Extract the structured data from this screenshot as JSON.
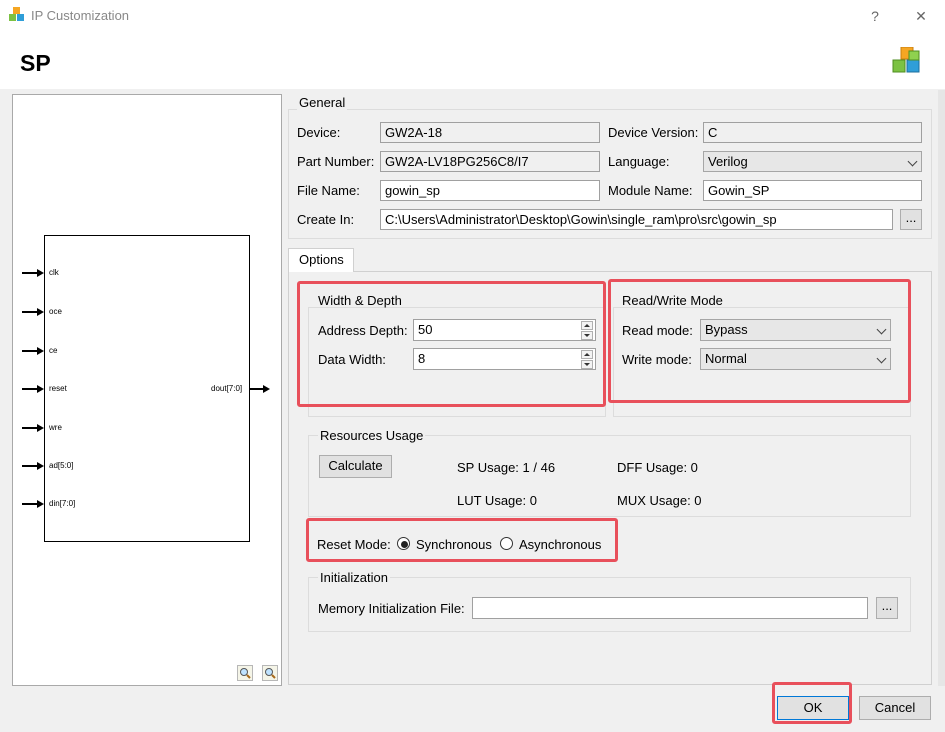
{
  "window": {
    "title": "IP Customization",
    "help_glyph": "?",
    "close_glyph": "✕"
  },
  "dialog": {
    "heading": "SP"
  },
  "preview": {
    "inputs": [
      "clk",
      "oce",
      "ce",
      "reset",
      "wre",
      "ad[5:0]",
      "din[7:0]"
    ],
    "output": "dout[7:0]"
  },
  "general": {
    "title": "General",
    "device_label": "Device:",
    "device_value": "GW2A-18",
    "device_version_label": "Device Version:",
    "device_version_value": "C",
    "part_number_label": "Part Number:",
    "part_number_value": "GW2A-LV18PG256C8/I7",
    "language_label": "Language:",
    "language_value": "Verilog",
    "file_name_label": "File Name:",
    "file_name_value": "gowin_sp",
    "module_name_label": "Module Name:",
    "module_name_value": "Gowin_SP",
    "create_in_label": "Create In:",
    "create_in_value": "C:\\Users\\Administrator\\Desktop\\Gowin\\single_ram\\pro\\src\\gowin_sp",
    "browse_label": "..."
  },
  "tabs": {
    "options": "Options"
  },
  "width_depth": {
    "title": "Width & Depth",
    "address_depth_label": "Address Depth:",
    "address_depth_value": "50",
    "data_width_label": "Data Width:",
    "data_width_value": "8"
  },
  "rw_mode": {
    "title": "Read/Write Mode",
    "read_mode_label": "Read mode:",
    "read_mode_value": "Bypass",
    "write_mode_label": "Write mode:",
    "write_mode_value": "Normal"
  },
  "resources": {
    "title": "Resources Usage",
    "calculate_label": "Calculate",
    "sp_usage": "SP Usage: 1 / 46",
    "dff_usage": "DFF Usage: 0",
    "lut_usage": "LUT Usage: 0",
    "mux_usage": "MUX Usage: 0"
  },
  "reset_mode": {
    "label": "Reset Mode:",
    "synchronous": "Synchronous",
    "asynchronous": "Asynchronous",
    "selected": "Synchronous"
  },
  "initialization": {
    "title": "Initialization",
    "file_label": "Memory Initialization File:",
    "file_value": "",
    "browse_label": "..."
  },
  "footer": {
    "ok_label": "OK",
    "cancel_label": "Cancel"
  },
  "colors": {
    "highlight": "#e8505b",
    "accent_green": "#7cc242",
    "accent_blue": "#2f9ed8",
    "accent_orange": "#f5a623"
  },
  "icons": {
    "app": "gowin-cube-icon",
    "zoom_in": "zoom-in-icon",
    "zoom_out": "zoom-out-icon"
  }
}
